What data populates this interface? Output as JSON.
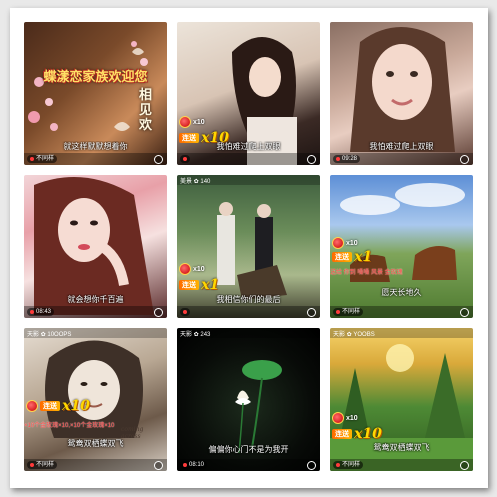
{
  "tiles": [
    {
      "overlay_title": "蝶漾恋家族欢迎您",
      "side_text": "相见欢",
      "caption": "就这样默默想着你",
      "time": "",
      "bottom_left": "不同样",
      "bg": "linear-gradient(135deg,#4a2a1a 0%,#7a4a2a 40%,#c98a5a 70%,#3a1f12 100%)"
    },
    {
      "combo_label": "连送",
      "gift_count": "x10",
      "multiplier": "x10",
      "caption": "我怕难过爬上双眼",
      "time": "",
      "bg": "linear-gradient(160deg,#ece4da 0%,#d8c4b4 45%,#3b2a25 75%,#1d1412 100%)"
    },
    {
      "caption": "我怕难过爬上双眼",
      "time": "09:28",
      "bg": "linear-gradient(160deg,#8a6f63 0%,#c9a99a 40%,#e8cdc1 60%,#5a3b31 100%)"
    },
    {
      "caption": "就会想你千百遍",
      "time": "08:43",
      "bg": "linear-gradient(160deg,#f2d5d8 0%,#e8a0a8 30%,#f6e1e0 55%,#5a2b2b 100%)"
    },
    {
      "status": "美景 ✿ 140",
      "gift_count": "x10",
      "combo_label": "连送",
      "multiplier": "x1",
      "caption": "我相信你们的最后",
      "bg": "linear-gradient(180deg,#3f5f3f 0%,#6b8d5a 40%,#a9b88c 70%,#3d3d2c 100%)"
    },
    {
      "gift_count": "x10",
      "combo_label": "连送",
      "multiplier": "x1",
      "ticker": "送给 你到 嗓嗓 风景 金玫瑰",
      "caption": "愿天长地久",
      "bottom_left": "不同样",
      "bg": "linear-gradient(180deg,#5d8fd6 0%,#a9c8ee 35%,#7fa55a 55%,#4e7a30 100%)"
    },
    {
      "status": "天影 ✿ 10OOPS",
      "combo_label": "连送",
      "multiplier": "x10",
      "ticker": "×10个金玫瑰×10,×10个金玫瑰×10",
      "side_text": "coming across",
      "caption": "鸳鸯双栖蝶双飞",
      "bottom_left": "不同样",
      "bg": "linear-gradient(160deg,#e6ddd2 0%,#b9a894 40%,#6d5a4a 70%,#d8cfc4 100%)"
    },
    {
      "status": "天影 ✿ 243",
      "caption": "偏偏你心门不是为我开",
      "time": "08:10",
      "bg": "radial-gradient(circle at 50% 55%,#1c2a1c 0%,#080b08 60%,#000 100%)"
    },
    {
      "status": "天影 ✿ YOOBS",
      "combo_label": "连送",
      "multiplier": "x10",
      "gift_count": "x10",
      "caption": "鸳鸯双栖蝶双飞",
      "bottom_left": "不同样",
      "bg": "linear-gradient(180deg,#f6d36a 0%,#d9a93a 25%,#4e8a35 55%,#2e5a1e 100%)"
    }
  ],
  "colors": {
    "frame_bg": "#ffffff",
    "page_bg": "#e9e9e9",
    "accent_gold": "#ffd700",
    "accent_red": "#ff3b3b"
  }
}
